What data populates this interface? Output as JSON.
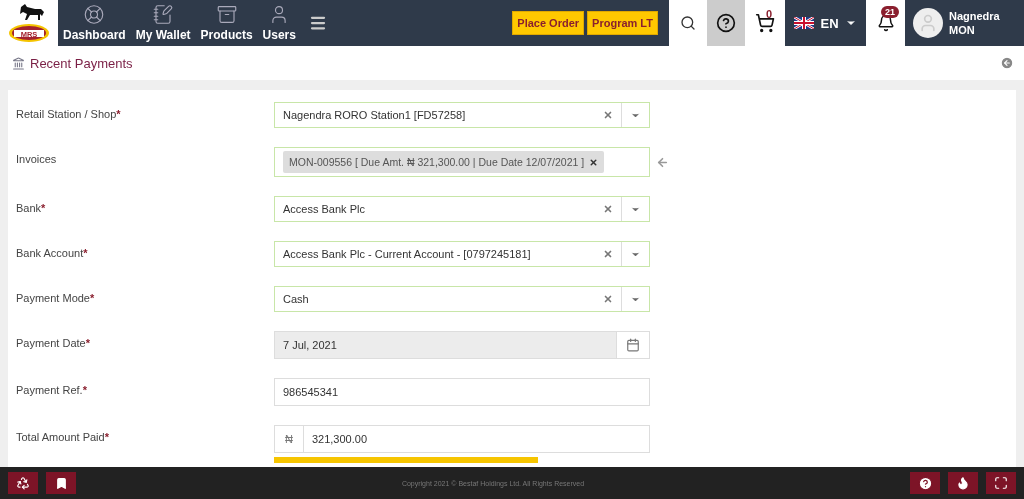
{
  "logo": {
    "text": "MRS"
  },
  "nav": [
    {
      "label": "Dashboard",
      "kind": "wheel"
    },
    {
      "label": "My Wallet",
      "kind": "wallet"
    },
    {
      "label": "Products",
      "kind": "box"
    },
    {
      "label": "Users",
      "kind": "user"
    }
  ],
  "actions": [
    "Place Order",
    "Program LT"
  ],
  "cart": {
    "count": "0"
  },
  "language": {
    "label": "EN"
  },
  "notifications": {
    "count": "21"
  },
  "user": {
    "name": "Nagnedra",
    "org": "MON"
  },
  "page_title": "Recent Payments",
  "required_mark": "*",
  "fields": [
    {
      "label": "Retail Station / Shop",
      "required": true,
      "kind": "select",
      "value": "Nagendra RORO Station1 [FD57258]"
    },
    {
      "label": "Invoices",
      "required": false,
      "kind": "tags",
      "tags": [
        "MON-009556 [ Due Amt. ₦ 321,300.00 | Due Date 12/07/2021 ]"
      ]
    },
    {
      "label": "Bank",
      "required": true,
      "kind": "select",
      "value": "Access Bank Plc"
    },
    {
      "label": "Bank Account",
      "required": true,
      "kind": "select",
      "value": "Access Bank Plc - Current Account - [0797245181]"
    },
    {
      "label": "Payment Mode",
      "required": true,
      "kind": "select",
      "value": "Cash"
    },
    {
      "label": "Payment Date",
      "required": true,
      "kind": "date",
      "value": "7 Jul, 2021",
      "disabled": true
    },
    {
      "label": "Payment Ref.",
      "required": true,
      "kind": "text",
      "value": "986545341"
    },
    {
      "label": "Total Amount Paid",
      "required": true,
      "kind": "currency",
      "prefix": "₦",
      "value": "321,300.00"
    }
  ],
  "footer": {
    "copyright": "Copyright 2021 © Bestaf Holdings Ltd. All Rights Reserved"
  }
}
